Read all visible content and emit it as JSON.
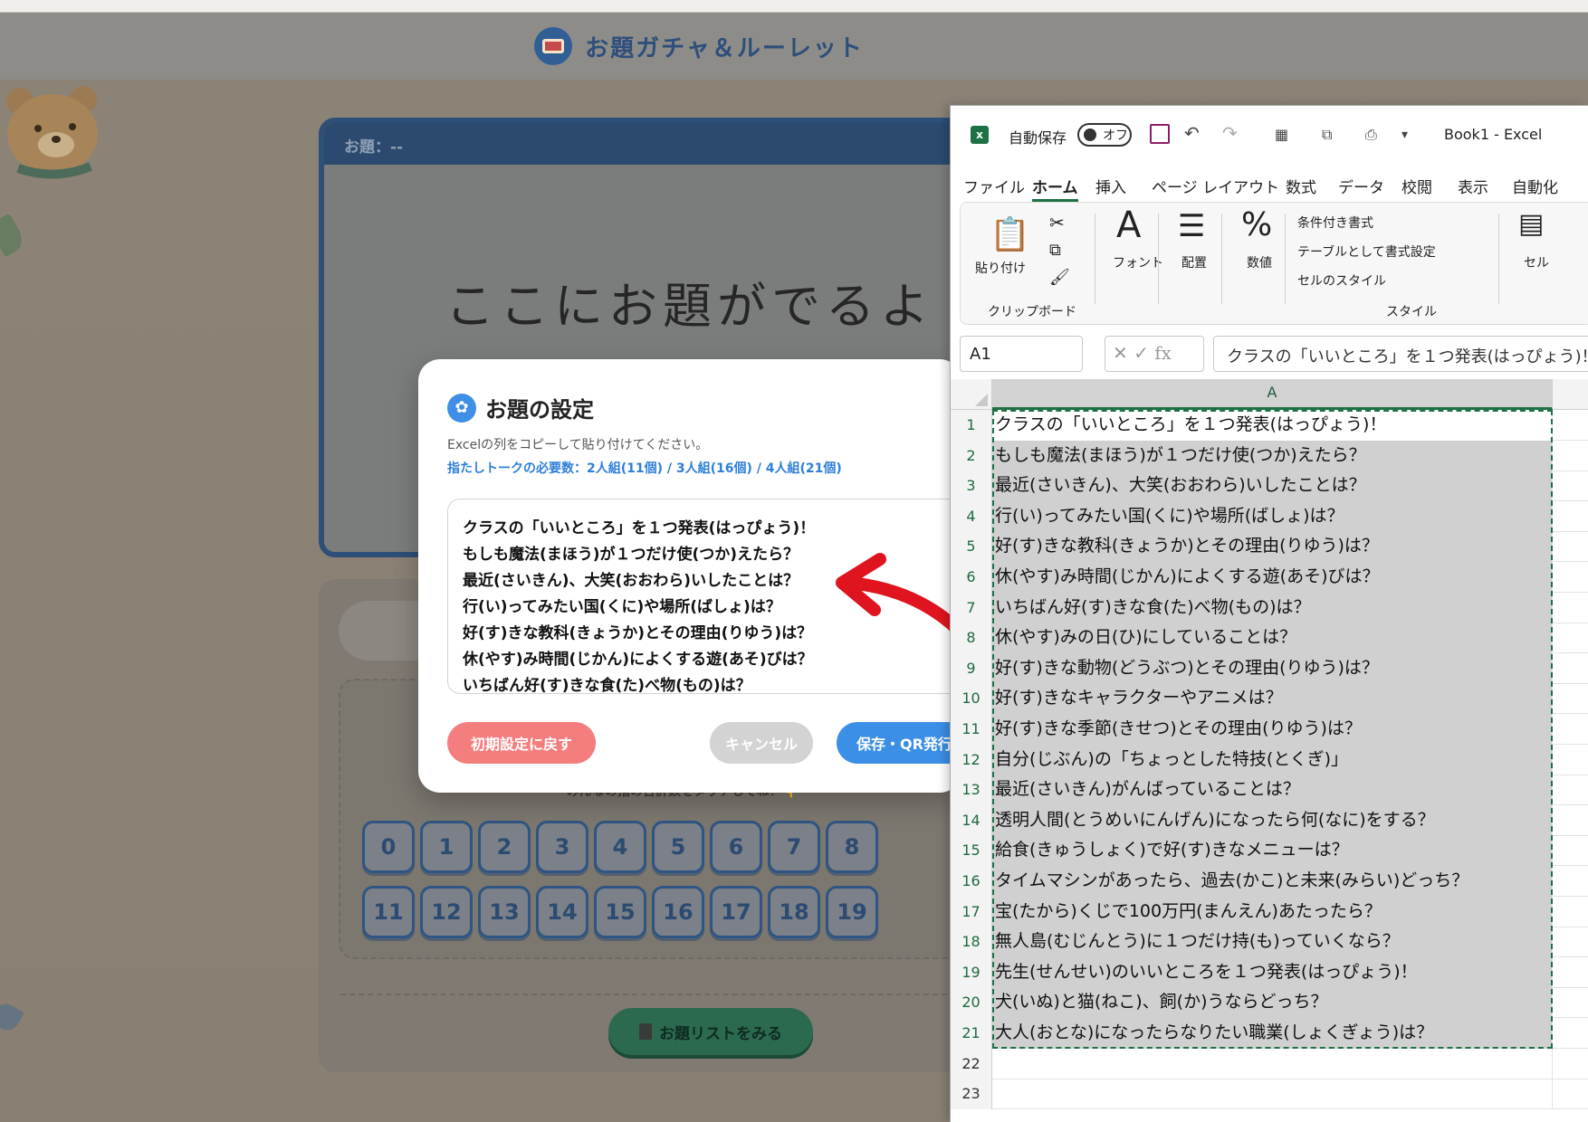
{
  "app": {
    "title": "お題ガチャ＆ルーレット"
  },
  "topic_card": {
    "header": "お題：--",
    "placeholder": "ここにお題がでるよ"
  },
  "number_pad": {
    "hint": "みんなの指の合計数をタッチしてね！👇",
    "row1": [
      "0",
      "1",
      "2",
      "3",
      "4",
      "5",
      "6",
      "7",
      "8"
    ],
    "row2": [
      "11",
      "12",
      "13",
      "14",
      "15",
      "16",
      "17",
      "18",
      "19"
    ]
  },
  "list_button": {
    "label": "お題リストをみる"
  },
  "modal": {
    "title": "お題の設定",
    "note": "Excelの列をコピーして貼り付けてください。",
    "requirement": "指たしトークの必要数：2人組(11個) / 3人組(16個) / 4人組(21個)",
    "textarea_lines": [
      "クラスの「いいところ」を１つ発表(はっぴょう)！",
      "もしも魔法(まほう)が１つだけ使(つか)えたら？",
      "最近(さいきん)、大笑(おおわら)いしたことは？",
      "行(い)ってみたい国(くに)や場所(ばしょ)は？",
      "好(す)きな教科(きょうか)とその理由(りゆう)は？",
      "休(やす)み時間(じかん)によくする遊(あそ)びは？",
      "いちばん好(す)きな食(た)べ物(もの)は？"
    ],
    "reset_label": "初期設定に戻す",
    "cancel_label": "キャンセル",
    "save_label": "保存・QR発行"
  },
  "excel": {
    "autosave_label": "自動保存",
    "autosave_state": "オフ",
    "book_title": "Book1  -  Excel",
    "tabs": [
      "ファイル",
      "ホーム",
      "挿入",
      "ページ レイアウト",
      "数式",
      "データ",
      "校閲",
      "表示",
      "自動化"
    ],
    "ribbon": {
      "paste": "貼り付け",
      "clipboard": "クリップボード",
      "font": "フォント",
      "alignment": "配置",
      "number": "数値",
      "conditional": "条件付き書式",
      "table_format": "テーブルとして書式設定",
      "cell_style": "セルのスタイル",
      "style_group": "スタイル",
      "cells": "セル"
    },
    "name_box": "A1",
    "formula_text": "クラスの「いいところ」を１つ発表(はっぴょう)！",
    "column_header": "A",
    "rows": [
      "クラスの「いいところ」を１つ発表(はっぴょう)！",
      "もしも魔法(まほう)が１つだけ使(つか)えたら？",
      "最近(さいきん)、大笑(おおわら)いしたことは？",
      "行(い)ってみたい国(くに)や場所(ばしょ)は？",
      "好(す)きな教科(きょうか)とその理由(りゆう)は？",
      "休(やす)み時間(じかん)によくする遊(あそ)びは？",
      "いちばん好(す)きな食(た)べ物(もの)は？",
      "休(やす)みの日(ひ)にしていることは？",
      "好(す)きな動物(どうぶつ)とその理由(りゆう)は？",
      "好(す)きなキャラクターやアニメは？",
      "好(す)きな季節(きせつ)とその理由(りゆう)は？",
      "自分(じぶん)の「ちょっとした特技(とくぎ)」",
      "最近(さいきん)がんばっていることは？",
      "透明人間(とうめいにんげん)になったら何(なに)をする？",
      "給食(きゅうしょく)で好(す)きなメニューは？",
      "タイムマシンがあったら、過去(かこ)と未来(みらい)どっち？",
      "宝(たから)くじで100万円(まんえん)あたったら？",
      "無人島(むじんとう)に１つだけ持(も)っていくなら？",
      "先生(せんせい)のいいところを１つ発表(はっぴょう)！",
      "犬(いぬ)と猫(ねこ)、飼(か)うならどっち？",
      "大人(おとな)になったらなりたい職業(しょくぎょう)は？",
      "",
      ""
    ],
    "row_numbers": [
      "1",
      "2",
      "3",
      "4",
      "5",
      "6",
      "7",
      "8",
      "9",
      "10",
      "11",
      "12",
      "13",
      "14",
      "15",
      "16",
      "17",
      "18",
      "19",
      "20",
      "21",
      "22",
      "23"
    ]
  },
  "colors": {
    "accent_blue": "#3b8fe6",
    "reset_red": "#f47e7e",
    "excel_green": "#1e7145",
    "annotation_arrow": "#e0141e"
  }
}
